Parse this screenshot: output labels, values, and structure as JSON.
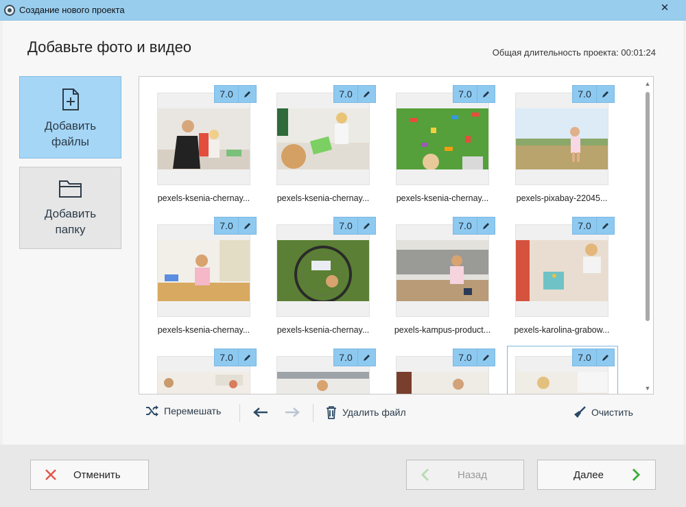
{
  "window": {
    "title": "Создание нового проекта",
    "close_label": "✕"
  },
  "header": {
    "title": "Добавьте фото и видео",
    "duration_label": "Общая длительность проекта: 00:01:24"
  },
  "sidebar": {
    "add_files_label": "Добавить файлы",
    "add_folder_label": "Добавить папку"
  },
  "tiles": [
    {
      "name": "pexels-ksenia-chernay...",
      "duration": "7.0"
    },
    {
      "name": "pexels-ksenia-chernay...",
      "duration": "7.0"
    },
    {
      "name": "pexels-ksenia-chernay...",
      "duration": "7.0"
    },
    {
      "name": "pexels-pixabay-22045...",
      "duration": "7.0"
    },
    {
      "name": "pexels-ksenia-chernay...",
      "duration": "7.0"
    },
    {
      "name": "pexels-ksenia-chernay...",
      "duration": "7.0"
    },
    {
      "name": "pexels-kampus-product...",
      "duration": "7.0"
    },
    {
      "name": "pexels-karolina-grabow...",
      "duration": "7.0"
    },
    {
      "name": "",
      "duration": "7.0"
    },
    {
      "name": "",
      "duration": "7.0"
    },
    {
      "name": "",
      "duration": "7.0"
    },
    {
      "name": "",
      "duration": "7.0"
    }
  ],
  "toolbar": {
    "shuffle_label": "Перемешать",
    "delete_label": "Удалить файл",
    "clear_label": "Очистить"
  },
  "footer": {
    "cancel_label": "Отменить",
    "back_label": "Назад",
    "next_label": "Далее"
  },
  "colors": {
    "accent": "#99cdee",
    "badge": "#8ec9f0",
    "cancel_icon": "#e2554a",
    "next_icon": "#3fae3a"
  }
}
